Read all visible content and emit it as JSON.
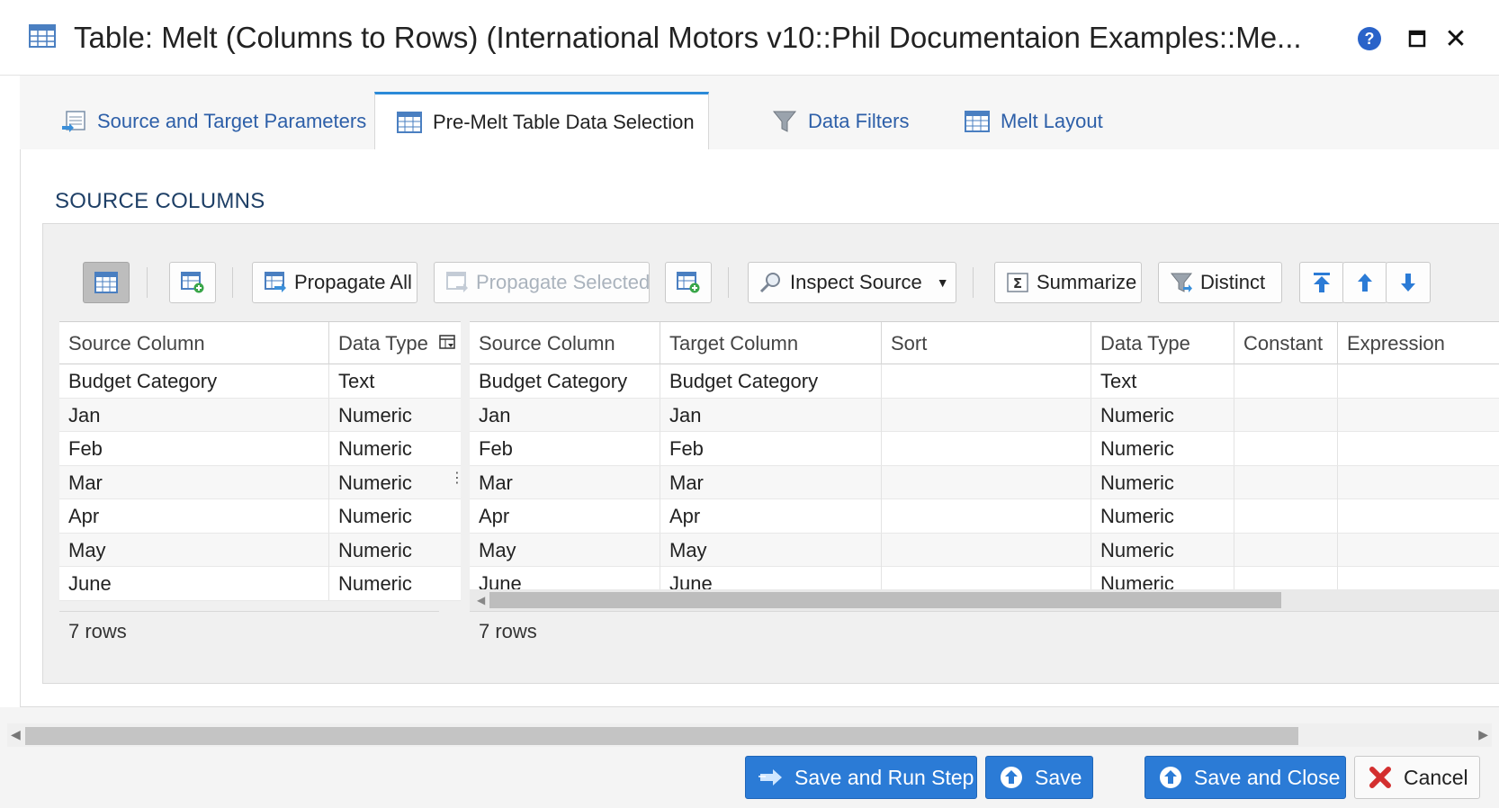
{
  "window": {
    "title": "Table: Melt (Columns to Rows) (International Motors v10::Phil Documentaion Examples::Me..."
  },
  "tabs": [
    {
      "label": "Source and Target Parameters"
    },
    {
      "label": "Pre-Melt Table Data Selection"
    },
    {
      "label": "Data Filters"
    },
    {
      "label": "Melt Layout"
    }
  ],
  "section": {
    "title": "SOURCE COLUMNS"
  },
  "toolbar": {
    "propagate_all": "Propagate All",
    "propagate_selected": "Propagate Selected",
    "inspect_source": "Inspect Source",
    "summarize": "Summarize",
    "distinct": "Distinct"
  },
  "left_grid": {
    "headers": [
      "Source Column",
      "Data Type"
    ],
    "rows": [
      [
        "Budget Category",
        "Text"
      ],
      [
        "Jan",
        "Numeric"
      ],
      [
        "Feb",
        "Numeric"
      ],
      [
        "Mar",
        "Numeric"
      ],
      [
        "Apr",
        "Numeric"
      ],
      [
        "May",
        "Numeric"
      ],
      [
        "June",
        "Numeric"
      ]
    ],
    "footer": "7 rows"
  },
  "right_grid": {
    "headers": [
      "Source Column",
      "Target Column",
      "Sort",
      "Data Type",
      "Constant",
      "Expression"
    ],
    "rows": [
      [
        "Budget Category",
        "Budget Category",
        "",
        "Text",
        "",
        ""
      ],
      [
        "Jan",
        "Jan",
        "",
        "Numeric",
        "",
        ""
      ],
      [
        "Feb",
        "Feb",
        "",
        "Numeric",
        "",
        ""
      ],
      [
        "Mar",
        "Mar",
        "",
        "Numeric",
        "",
        ""
      ],
      [
        "Apr",
        "Apr",
        "",
        "Numeric",
        "",
        ""
      ],
      [
        "May",
        "May",
        "",
        "Numeric",
        "",
        ""
      ],
      [
        "June",
        "June",
        "",
        "Numeric",
        "",
        ""
      ]
    ],
    "footer": "7 rows"
  },
  "buttons": {
    "save_and_run": "Save and Run Step",
    "save": "Save",
    "save_and_close": "Save and Close",
    "cancel": "Cancel"
  },
  "colors": {
    "primary": "#2b7bd6",
    "tab_link": "#2d5fa8",
    "section_title": "#1e3f66",
    "help_icon": "#2a63c9",
    "cancel_icon": "#d32f2f"
  }
}
